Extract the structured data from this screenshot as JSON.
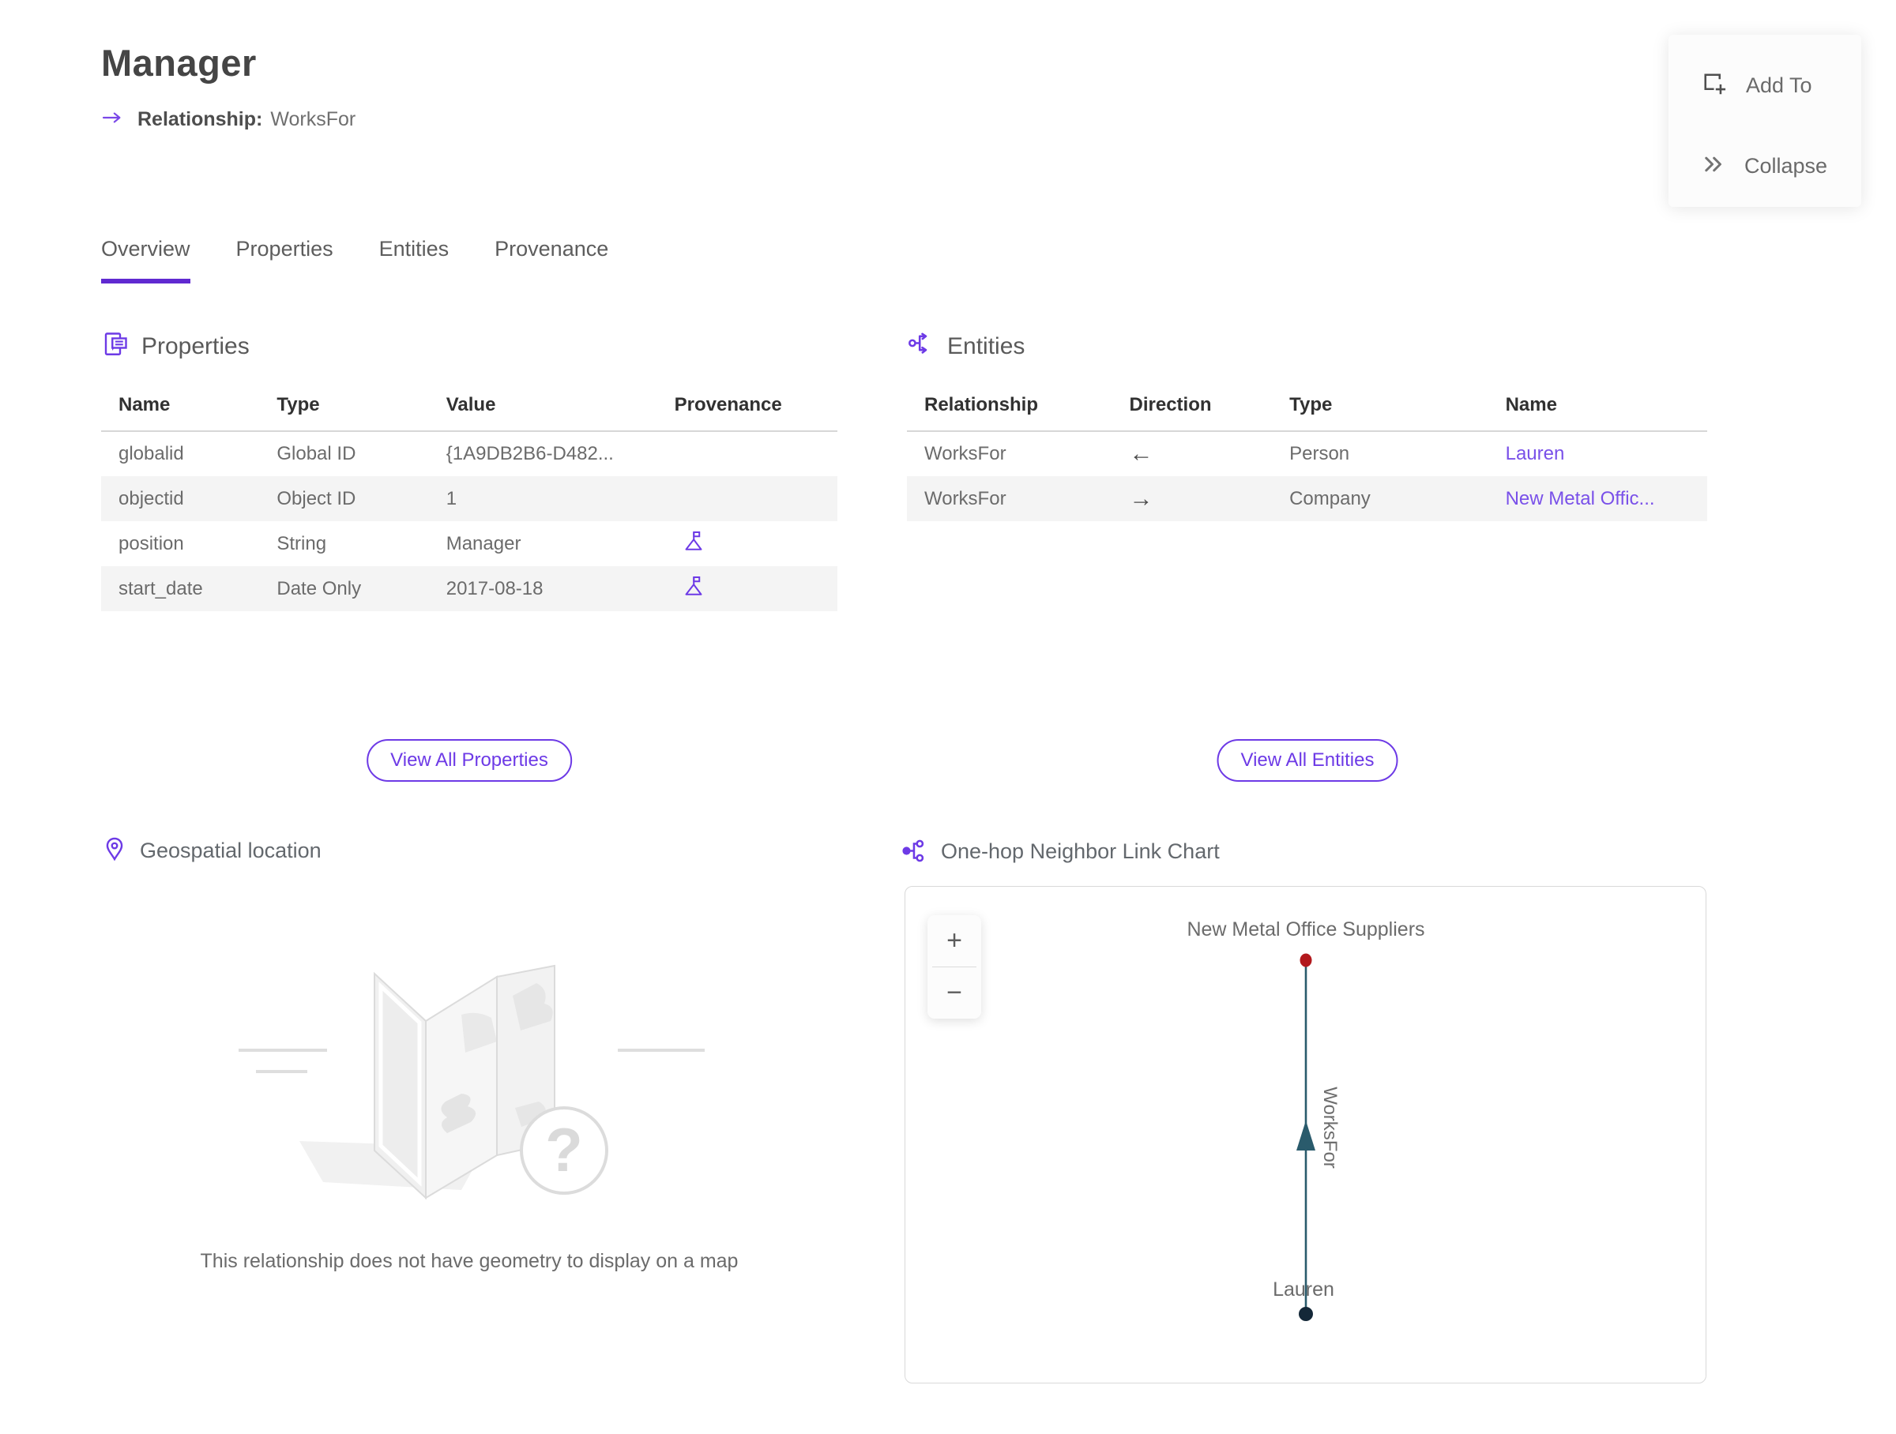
{
  "page": {
    "title": "Manager",
    "subtitle_label": "Relationship:",
    "subtitle_value": "WorksFor"
  },
  "actions": {
    "add_to_label": "Add To",
    "collapse_label": "Collapse"
  },
  "tabs": [
    {
      "label": "Overview",
      "active": true
    },
    {
      "label": "Properties",
      "active": false
    },
    {
      "label": "Entities",
      "active": false
    },
    {
      "label": "Provenance",
      "active": false
    }
  ],
  "properties_section": {
    "title": "Properties",
    "icon": "document-list-icon",
    "columns": {
      "name": "Name",
      "type": "Type",
      "value": "Value",
      "provenance": "Provenance"
    },
    "rows": [
      {
        "name": "globalid",
        "type": "Global ID",
        "value": "{1A9DB2B6-D482...",
        "has_provenance": false
      },
      {
        "name": "objectid",
        "type": "Object ID",
        "value": "1",
        "has_provenance": false
      },
      {
        "name": "position",
        "type": "String",
        "value": "Manager",
        "has_provenance": true
      },
      {
        "name": "start_date",
        "type": "Date Only",
        "value": "2017-08-18",
        "has_provenance": true
      }
    ],
    "view_all_label": "View All Properties"
  },
  "entities_section": {
    "title": "Entities",
    "icon": "share-out-icon",
    "columns": {
      "relationship": "Relationship",
      "direction": "Direction",
      "type": "Type",
      "name": "Name"
    },
    "rows": [
      {
        "relationship": "WorksFor",
        "direction": "←",
        "type": "Person",
        "name": "Lauren"
      },
      {
        "relationship": "WorksFor",
        "direction": "→",
        "type": "Company",
        "name": "New Metal Offic..."
      }
    ],
    "view_all_label": "View All Entities"
  },
  "geospatial_section": {
    "title": "Geospatial location",
    "icon": "map-pin-icon",
    "empty_message": "This relationship does not have geometry to display on a map"
  },
  "link_chart_section": {
    "title": "One-hop Neighbor Link Chart",
    "icon": "one-hop-icon",
    "zoom_in_label": "+",
    "zoom_out_label": "−",
    "chart_data": {
      "type": "link-chart",
      "nodes": [
        {
          "label": "New Metal Office Suppliers",
          "color": "#b2191d",
          "position": "top"
        },
        {
          "label": "Lauren",
          "color": "#142838",
          "position": "bottom"
        }
      ],
      "edges": [
        {
          "label": "WorksFor",
          "from": "Lauren",
          "to": "New Metal Office Suppliers",
          "direction": "up",
          "color": "#2a5b6c"
        }
      ],
      "legend": false,
      "grid": false
    }
  },
  "colors": {
    "accent_purple": "#6d3ae6",
    "link_purple": "#7950e9",
    "tab_underline": "#6029d1",
    "edge_teal": "#2a5b6c",
    "node_red": "#b2191d",
    "node_navy": "#142838",
    "row_stripe": "#f4f4f4"
  }
}
